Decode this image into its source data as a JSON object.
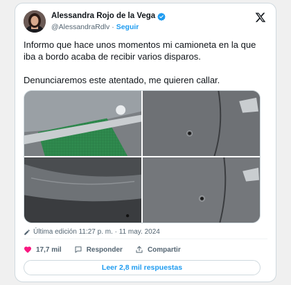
{
  "author": {
    "display_name": "Alessandra Rojo de la Vega",
    "handle": "@AlessandraRdlv",
    "separator": "·",
    "follow_label": "Seguir"
  },
  "tweet": {
    "text": "Informo que hace unos momentos mi camioneta en la que iba a bordo acaba de recibir varios disparos.\n\nDenunciaremos este atentado, me quieren callar."
  },
  "meta": {
    "edited_label": "Última edición 11:27 p. m. · 11 may. 2024"
  },
  "actions": {
    "like_count": "17,7 mil",
    "reply_label": "Responder",
    "share_label": "Compartir"
  },
  "read_replies": {
    "label": "Leer 2,8 mil respuestas"
  },
  "icons": {
    "verified": "verified-badge-icon",
    "brand": "x-logo-icon",
    "edit": "pencil-icon",
    "like": "heart-icon",
    "reply": "speech-bubble-icon",
    "share": "share-upload-icon"
  },
  "colors": {
    "accent": "#1d9bf0",
    "like": "#f91880",
    "secondary_text": "#536471",
    "border": "#cfd9de"
  }
}
